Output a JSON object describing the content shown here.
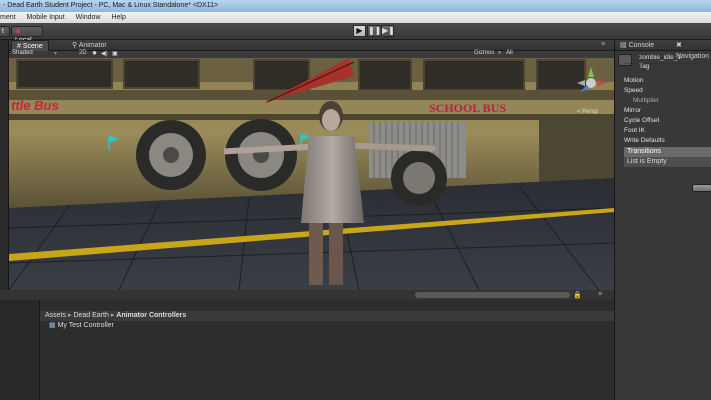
{
  "window": {
    "title": "- Dead Earth Student Project - PC, Mac & Linux Standalone* <DX11>"
  },
  "menu": {
    "items": [
      "ment",
      "Mobile Input",
      "Window",
      "Help"
    ]
  },
  "toolbar": {
    "pivot_label": "t",
    "local_label": "Local",
    "play_icon": "play-icon",
    "pause_icon": "pause-icon",
    "step_icon": "step-icon"
  },
  "scene": {
    "tabs": [
      {
        "label": "Scene",
        "icon": "hash-icon"
      },
      {
        "label": "Animator",
        "icon": "animator-icon"
      }
    ],
    "shading": "Shaded",
    "mode": "2D",
    "gizmos": "Gizmos",
    "search_all": "All",
    "persp": "< Persp",
    "bus_sign_left": "ttle Bus",
    "bus_sign_right": "SCHOOL BUS"
  },
  "inspector": {
    "tabs": [
      "Console",
      "Navigation"
    ],
    "name": "zombie_idle_1",
    "tag": "Tag",
    "rows": [
      "Motion",
      "Speed",
      "Multiplier",
      "Mirror",
      "Cycle Offset",
      "Foot IK",
      "Write Defaults"
    ],
    "transitions": "Transitions",
    "list_empty": "List is Empty"
  },
  "project": {
    "breadcrumb": [
      "Assets",
      "Dead Earth",
      "Animator Controllers"
    ],
    "items": [
      "My Test Controller"
    ]
  }
}
